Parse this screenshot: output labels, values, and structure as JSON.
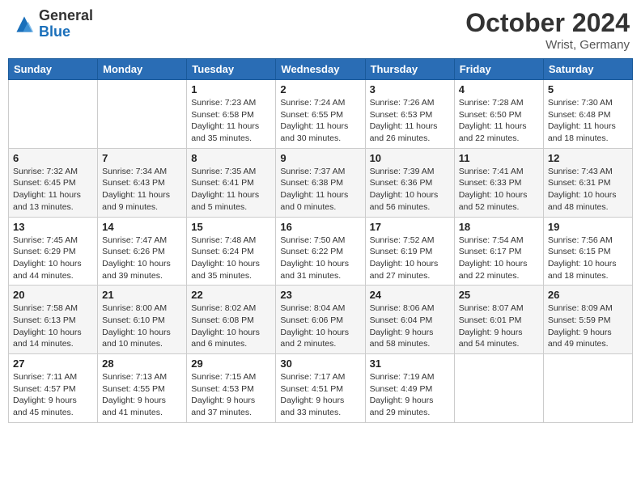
{
  "header": {
    "logo_general": "General",
    "logo_blue": "Blue",
    "month_title": "October 2024",
    "location": "Wrist, Germany"
  },
  "days_of_week": [
    "Sunday",
    "Monday",
    "Tuesday",
    "Wednesday",
    "Thursday",
    "Friday",
    "Saturday"
  ],
  "weeks": [
    [
      {
        "day": "",
        "sunrise": "",
        "sunset": "",
        "daylight": ""
      },
      {
        "day": "",
        "sunrise": "",
        "sunset": "",
        "daylight": ""
      },
      {
        "day": "1",
        "sunrise": "Sunrise: 7:23 AM",
        "sunset": "Sunset: 6:58 PM",
        "daylight": "Daylight: 11 hours and 35 minutes."
      },
      {
        "day": "2",
        "sunrise": "Sunrise: 7:24 AM",
        "sunset": "Sunset: 6:55 PM",
        "daylight": "Daylight: 11 hours and 30 minutes."
      },
      {
        "day": "3",
        "sunrise": "Sunrise: 7:26 AM",
        "sunset": "Sunset: 6:53 PM",
        "daylight": "Daylight: 11 hours and 26 minutes."
      },
      {
        "day": "4",
        "sunrise": "Sunrise: 7:28 AM",
        "sunset": "Sunset: 6:50 PM",
        "daylight": "Daylight: 11 hours and 22 minutes."
      },
      {
        "day": "5",
        "sunrise": "Sunrise: 7:30 AM",
        "sunset": "Sunset: 6:48 PM",
        "daylight": "Daylight: 11 hours and 18 minutes."
      }
    ],
    [
      {
        "day": "6",
        "sunrise": "Sunrise: 7:32 AM",
        "sunset": "Sunset: 6:45 PM",
        "daylight": "Daylight: 11 hours and 13 minutes."
      },
      {
        "day": "7",
        "sunrise": "Sunrise: 7:34 AM",
        "sunset": "Sunset: 6:43 PM",
        "daylight": "Daylight: 11 hours and 9 minutes."
      },
      {
        "day": "8",
        "sunrise": "Sunrise: 7:35 AM",
        "sunset": "Sunset: 6:41 PM",
        "daylight": "Daylight: 11 hours and 5 minutes."
      },
      {
        "day": "9",
        "sunrise": "Sunrise: 7:37 AM",
        "sunset": "Sunset: 6:38 PM",
        "daylight": "Daylight: 11 hours and 0 minutes."
      },
      {
        "day": "10",
        "sunrise": "Sunrise: 7:39 AM",
        "sunset": "Sunset: 6:36 PM",
        "daylight": "Daylight: 10 hours and 56 minutes."
      },
      {
        "day": "11",
        "sunrise": "Sunrise: 7:41 AM",
        "sunset": "Sunset: 6:33 PM",
        "daylight": "Daylight: 10 hours and 52 minutes."
      },
      {
        "day": "12",
        "sunrise": "Sunrise: 7:43 AM",
        "sunset": "Sunset: 6:31 PM",
        "daylight": "Daylight: 10 hours and 48 minutes."
      }
    ],
    [
      {
        "day": "13",
        "sunrise": "Sunrise: 7:45 AM",
        "sunset": "Sunset: 6:29 PM",
        "daylight": "Daylight: 10 hours and 44 minutes."
      },
      {
        "day": "14",
        "sunrise": "Sunrise: 7:47 AM",
        "sunset": "Sunset: 6:26 PM",
        "daylight": "Daylight: 10 hours and 39 minutes."
      },
      {
        "day": "15",
        "sunrise": "Sunrise: 7:48 AM",
        "sunset": "Sunset: 6:24 PM",
        "daylight": "Daylight: 10 hours and 35 minutes."
      },
      {
        "day": "16",
        "sunrise": "Sunrise: 7:50 AM",
        "sunset": "Sunset: 6:22 PM",
        "daylight": "Daylight: 10 hours and 31 minutes."
      },
      {
        "day": "17",
        "sunrise": "Sunrise: 7:52 AM",
        "sunset": "Sunset: 6:19 PM",
        "daylight": "Daylight: 10 hours and 27 minutes."
      },
      {
        "day": "18",
        "sunrise": "Sunrise: 7:54 AM",
        "sunset": "Sunset: 6:17 PM",
        "daylight": "Daylight: 10 hours and 22 minutes."
      },
      {
        "day": "19",
        "sunrise": "Sunrise: 7:56 AM",
        "sunset": "Sunset: 6:15 PM",
        "daylight": "Daylight: 10 hours and 18 minutes."
      }
    ],
    [
      {
        "day": "20",
        "sunrise": "Sunrise: 7:58 AM",
        "sunset": "Sunset: 6:13 PM",
        "daylight": "Daylight: 10 hours and 14 minutes."
      },
      {
        "day": "21",
        "sunrise": "Sunrise: 8:00 AM",
        "sunset": "Sunset: 6:10 PM",
        "daylight": "Daylight: 10 hours and 10 minutes."
      },
      {
        "day": "22",
        "sunrise": "Sunrise: 8:02 AM",
        "sunset": "Sunset: 6:08 PM",
        "daylight": "Daylight: 10 hours and 6 minutes."
      },
      {
        "day": "23",
        "sunrise": "Sunrise: 8:04 AM",
        "sunset": "Sunset: 6:06 PM",
        "daylight": "Daylight: 10 hours and 2 minutes."
      },
      {
        "day": "24",
        "sunrise": "Sunrise: 8:06 AM",
        "sunset": "Sunset: 6:04 PM",
        "daylight": "Daylight: 9 hours and 58 minutes."
      },
      {
        "day": "25",
        "sunrise": "Sunrise: 8:07 AM",
        "sunset": "Sunset: 6:01 PM",
        "daylight": "Daylight: 9 hours and 54 minutes."
      },
      {
        "day": "26",
        "sunrise": "Sunrise: 8:09 AM",
        "sunset": "Sunset: 5:59 PM",
        "daylight": "Daylight: 9 hours and 49 minutes."
      }
    ],
    [
      {
        "day": "27",
        "sunrise": "Sunrise: 7:11 AM",
        "sunset": "Sunset: 4:57 PM",
        "daylight": "Daylight: 9 hours and 45 minutes."
      },
      {
        "day": "28",
        "sunrise": "Sunrise: 7:13 AM",
        "sunset": "Sunset: 4:55 PM",
        "daylight": "Daylight: 9 hours and 41 minutes."
      },
      {
        "day": "29",
        "sunrise": "Sunrise: 7:15 AM",
        "sunset": "Sunset: 4:53 PM",
        "daylight": "Daylight: 9 hours and 37 minutes."
      },
      {
        "day": "30",
        "sunrise": "Sunrise: 7:17 AM",
        "sunset": "Sunset: 4:51 PM",
        "daylight": "Daylight: 9 hours and 33 minutes."
      },
      {
        "day": "31",
        "sunrise": "Sunrise: 7:19 AM",
        "sunset": "Sunset: 4:49 PM",
        "daylight": "Daylight: 9 hours and 29 minutes."
      },
      {
        "day": "",
        "sunrise": "",
        "sunset": "",
        "daylight": ""
      },
      {
        "day": "",
        "sunrise": "",
        "sunset": "",
        "daylight": ""
      }
    ]
  ]
}
